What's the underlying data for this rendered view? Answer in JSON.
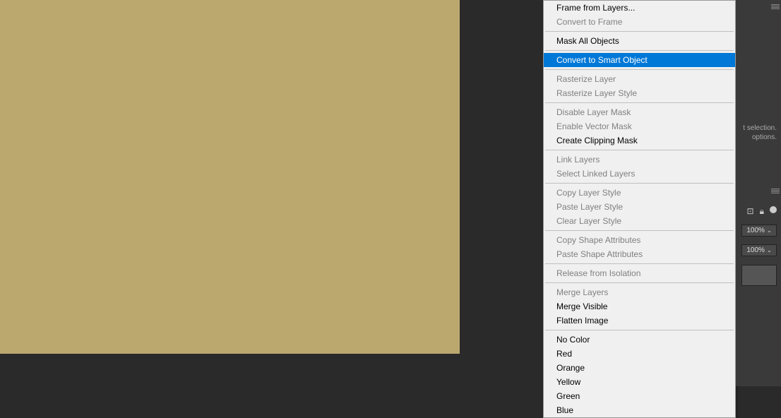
{
  "canvas": {
    "color": "#bba86e"
  },
  "menu": {
    "items": [
      {
        "label": "Frame from Layers...",
        "enabled": true
      },
      {
        "label": "Convert to Frame",
        "enabled": false
      },
      {
        "sep": true
      },
      {
        "label": "Mask All Objects",
        "enabled": true
      },
      {
        "sep": true
      },
      {
        "label": "Convert to Smart Object",
        "enabled": true,
        "highlighted": true
      },
      {
        "sep": true
      },
      {
        "label": "Rasterize Layer",
        "enabled": false
      },
      {
        "label": "Rasterize Layer Style",
        "enabled": false
      },
      {
        "sep": true
      },
      {
        "label": "Disable Layer Mask",
        "enabled": false
      },
      {
        "label": "Enable Vector Mask",
        "enabled": false
      },
      {
        "label": "Create Clipping Mask",
        "enabled": true
      },
      {
        "sep": true
      },
      {
        "label": "Link Layers",
        "enabled": false
      },
      {
        "label": "Select Linked Layers",
        "enabled": false
      },
      {
        "sep": true
      },
      {
        "label": "Copy Layer Style",
        "enabled": false
      },
      {
        "label": "Paste Layer Style",
        "enabled": false
      },
      {
        "label": "Clear Layer Style",
        "enabled": false
      },
      {
        "sep": true
      },
      {
        "label": "Copy Shape Attributes",
        "enabled": false
      },
      {
        "label": "Paste Shape Attributes",
        "enabled": false
      },
      {
        "sep": true
      },
      {
        "label": "Release from Isolation",
        "enabled": false
      },
      {
        "sep": true
      },
      {
        "label": "Merge Layers",
        "enabled": false
      },
      {
        "label": "Merge Visible",
        "enabled": true
      },
      {
        "label": "Flatten Image",
        "enabled": true
      },
      {
        "sep": true
      },
      {
        "label": "No Color",
        "enabled": true
      },
      {
        "label": "Red",
        "enabled": true
      },
      {
        "label": "Orange",
        "enabled": true
      },
      {
        "label": "Yellow",
        "enabled": true
      },
      {
        "label": "Green",
        "enabled": true
      },
      {
        "label": "Blue",
        "enabled": true
      }
    ]
  },
  "panel": {
    "hint_line1": "t selection.",
    "hint_line2": "options.",
    "opacity": "100%",
    "fill": "100%"
  }
}
